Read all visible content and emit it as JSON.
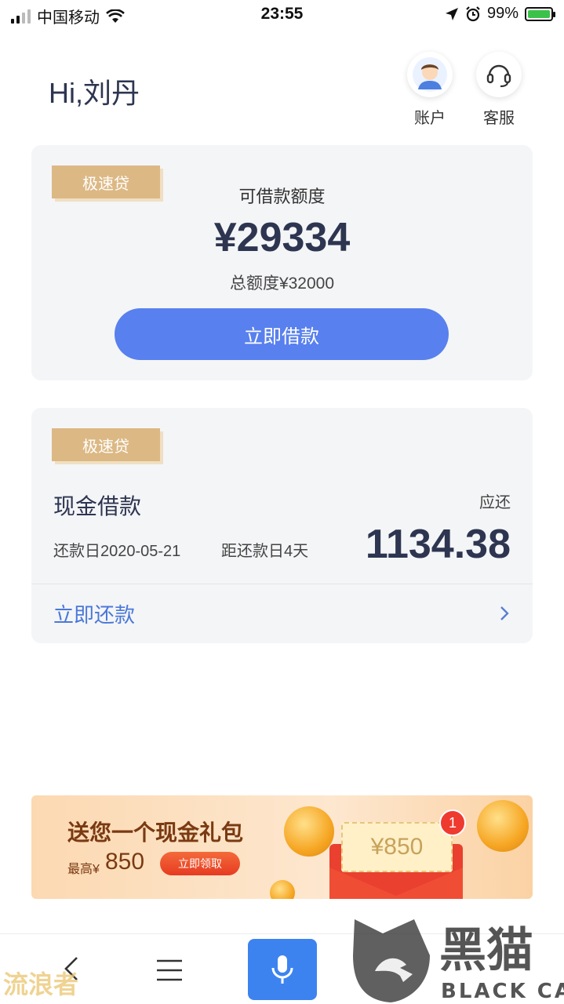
{
  "status_bar": {
    "carrier": "中国移动",
    "time": "23:55",
    "battery": "99%"
  },
  "header": {
    "greeting": "Hi,刘丹",
    "account_label": "账户",
    "service_label": "客服"
  },
  "credit_card": {
    "tag": "极速贷",
    "title": "可借款额度",
    "amount": "¥29334",
    "total": "总额度¥32000",
    "button": "立即借款"
  },
  "repay_card": {
    "tag": "极速贷",
    "title": "现金借款",
    "due_label": "应还",
    "due_date": "还款日2020-05-21",
    "days_left": "距还款日4天",
    "amount": "1134.38",
    "repay_link": "立即还款"
  },
  "banner": {
    "title": "送您一个现金礼包",
    "prefix": "最高¥",
    "amount": "850",
    "button": "立即领取",
    "card_amount": "¥850",
    "badge": "1"
  },
  "watermark": {
    "left_text": "流浪者",
    "logo_text": "黑猫",
    "logo_sub": "BLACK CAT"
  },
  "colors": {
    "primary": "#5880ee",
    "navy": "#2d3550",
    "gold": "#dcb884",
    "link": "#4a78d8"
  }
}
